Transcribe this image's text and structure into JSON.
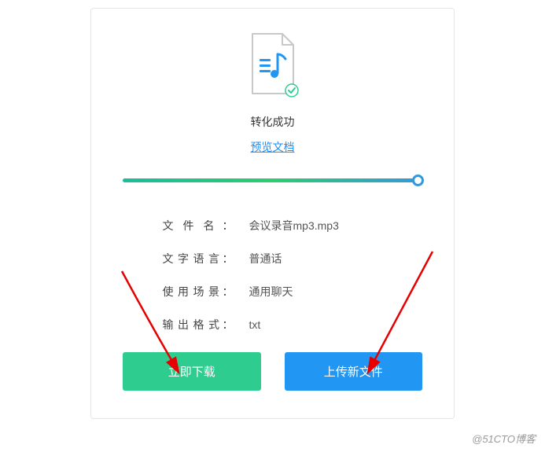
{
  "status": {
    "text": "转化成功",
    "preview_link": "预览文档"
  },
  "info": {
    "filename_label": "文件名",
    "filename_value": "会议录音mp3.mp3",
    "language_label": "文字语言",
    "language_value": "普通话",
    "scene_label": "使用场景",
    "scene_value": "通用聊天",
    "output_label": "输出格式",
    "output_value": "txt"
  },
  "buttons": {
    "download": "立即下载",
    "upload": "上传新文件"
  },
  "watermark": "@51CTO博客",
  "colors": {
    "primary_blue": "#2196f3",
    "success_green": "#2ecc8f",
    "link_blue": "#1890ff"
  }
}
